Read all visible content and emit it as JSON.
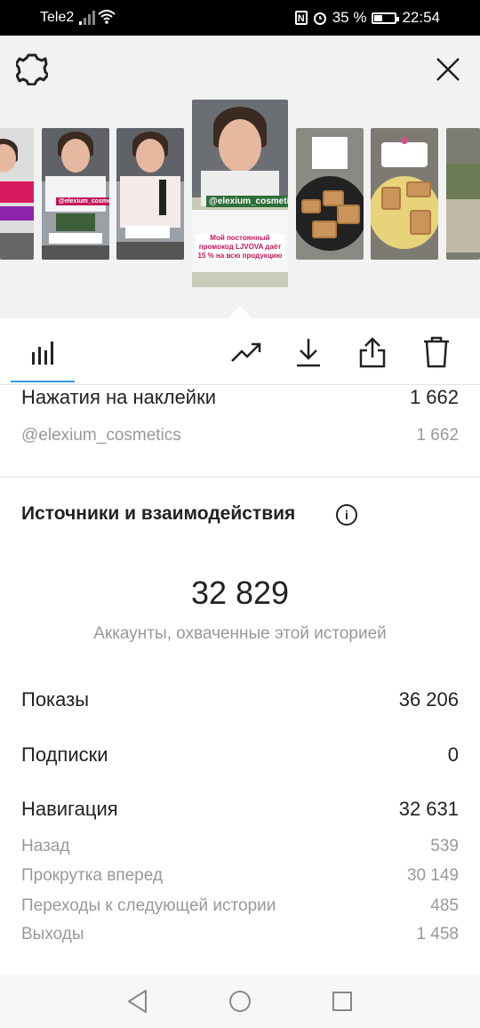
{
  "status_bar": {
    "carrier": "Tele2",
    "battery": "35 %",
    "battery_level": 0.35,
    "time": "22:54"
  },
  "header": {
    "settings_icon": "gear-icon",
    "close_icon": "close-icon"
  },
  "stories": {
    "selected_tag": "@elexium_cosmetics",
    "selected_caption": "Мой постоянный промокод LJVOVA даёт 15 % на всю продукцию",
    "thumb_tag": "@elexium_cosmetics"
  },
  "toolbar": {
    "tabs": [
      "bar-chart-icon",
      "trending-icon",
      "download-icon",
      "share-icon",
      "trash-icon"
    ]
  },
  "sticker_taps": {
    "label": "Нажатия на наклейки",
    "value": "1 662",
    "items": [
      {
        "label": "@elexium_cosmetics",
        "value": "1 662"
      }
    ]
  },
  "sources": {
    "title": "Источники и взаимодействия",
    "reach_value": "32 829",
    "reach_label": "Аккаунты, охваченные этой историей",
    "impressions_label": "Показы",
    "impressions_value": "36 206",
    "follows_label": "Подписки",
    "follows_value": "0",
    "navigation_label": "Навигация",
    "navigation_value": "32 631",
    "navigation_items": [
      {
        "label": "Назад",
        "value": "539"
      },
      {
        "label": "Прокрутка вперед",
        "value": "30 149"
      },
      {
        "label": "Переходы к следующей истории",
        "value": "485"
      },
      {
        "label": "Выходы",
        "value": "1 458"
      }
    ]
  }
}
